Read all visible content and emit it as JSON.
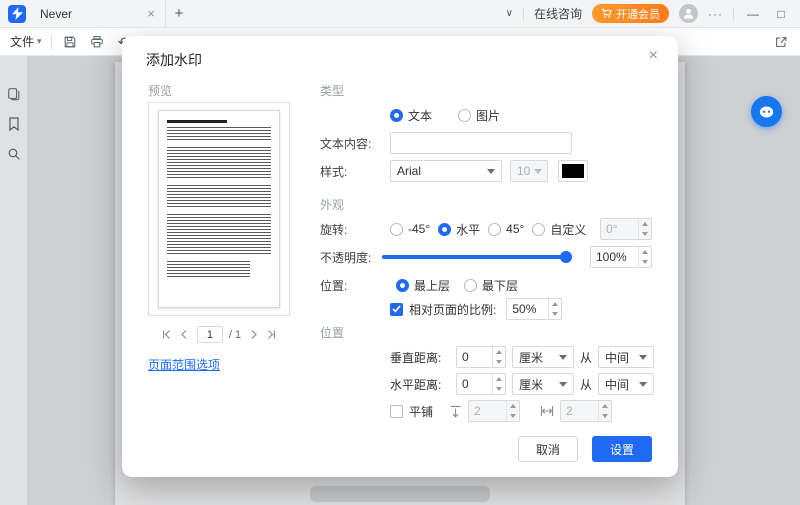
{
  "colors": {
    "accent": "#2069f2",
    "membership_orange": "#ff7a1c"
  },
  "icons": {
    "chevron_down": "∨",
    "plus": "+",
    "close": "×",
    "ellipsis": "···",
    "minimize": "—",
    "maximize": "□",
    "caret_down": "▾",
    "undo": "↶",
    "redo": "↷"
  },
  "titlebar": {
    "tab_title": "Never",
    "consult_label": "在线咨询",
    "membership_label": "开通会员"
  },
  "toolbar": {
    "file_label": "文件"
  },
  "dialog": {
    "title": "添加水印",
    "preview": {
      "label": "预览",
      "page_current": "1",
      "page_total": "/ 1",
      "range_link": "页面范围选项"
    },
    "type": {
      "section": "类型",
      "text": "文本",
      "image": "图片",
      "content_label": "文本内容:",
      "content_value": "",
      "style_label": "样式:",
      "font": "Arial",
      "size": "10"
    },
    "appearance": {
      "section": "外观",
      "rotation_label": "旋转:",
      "neg45": "-45°",
      "horizontal": "水平",
      "pos45": "45°",
      "custom": "自定义",
      "custom_value": "0°",
      "opacity_label": "不透明度:",
      "opacity_value": "100%",
      "layer_label": "位置:",
      "top": "最上层",
      "bottom": "最下层",
      "scale_label": "相对页面的比例:",
      "scale_value": "50%"
    },
    "position": {
      "section": "位置",
      "vertical_label": "垂直距离:",
      "horizontal_label": "水平距离:",
      "value_v": "0",
      "value_h": "0",
      "unit": "厘米",
      "from": "从",
      "anchor": "中间",
      "tile": "平铺",
      "tile_v": "2",
      "tile_h": "2"
    },
    "footer": {
      "cancel": "取消",
      "apply": "设置"
    }
  }
}
